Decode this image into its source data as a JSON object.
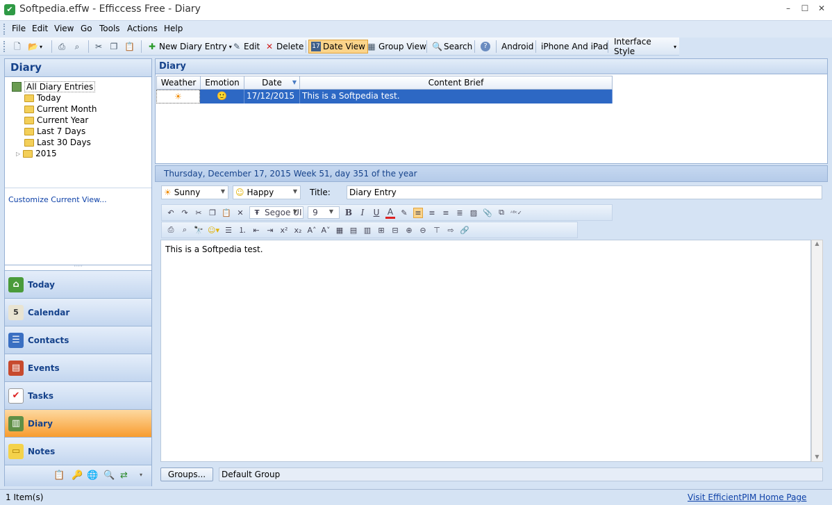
{
  "window": {
    "title": "Softpedia.effw - Efficcess Free - Diary",
    "min": "–",
    "max": "☐",
    "close": "✕"
  },
  "menu": [
    "File",
    "Edit",
    "View",
    "Go",
    "Tools",
    "Actions",
    "Help"
  ],
  "toolbar": {
    "new_entry": "New Diary Entry",
    "edit": "Edit",
    "delete": "Delete",
    "date_view": "Date View",
    "group_view": "Group View",
    "search": "Search",
    "android": "Android",
    "iphone": "iPhone And iPad",
    "interface_style": "Interface Style"
  },
  "left": {
    "title": "Diary",
    "tree": [
      "All Diary Entries",
      "Today",
      "Current Month",
      "Current Year",
      "Last 7 Days",
      "Last 30 Days",
      "2015"
    ],
    "customize": "Customize Current View...",
    "nav": [
      "Today",
      "Calendar",
      "Contacts",
      "Events",
      "Tasks",
      "Diary",
      "Notes"
    ]
  },
  "grid": {
    "title": "Diary",
    "columns": [
      "Weather",
      "Emotion",
      "Date",
      "Content Brief"
    ],
    "rows": [
      {
        "weather": "☀",
        "emotion": "🙂",
        "date": "17/12/2015",
        "brief": "This is a Softpedia test."
      }
    ]
  },
  "entry": {
    "date_header": "Thursday, December 17, 2015   Week 51, day 351 of the year",
    "weather": "Sunny",
    "emotion": "Happy",
    "title_label": "Title:",
    "title_value": "Diary Entry",
    "font": "Segoe UI",
    "size": "9",
    "body": "This is a Softpedia test.",
    "groups_button": "Groups...",
    "group_value": "Default Group"
  },
  "status": {
    "items": "1 Item(s)",
    "link": "Visit EfficientPIM Home Page"
  },
  "colors": {
    "accent": "#15428b",
    "selected_row": "#2d68c4",
    "active_nav": "#f89c2f"
  }
}
